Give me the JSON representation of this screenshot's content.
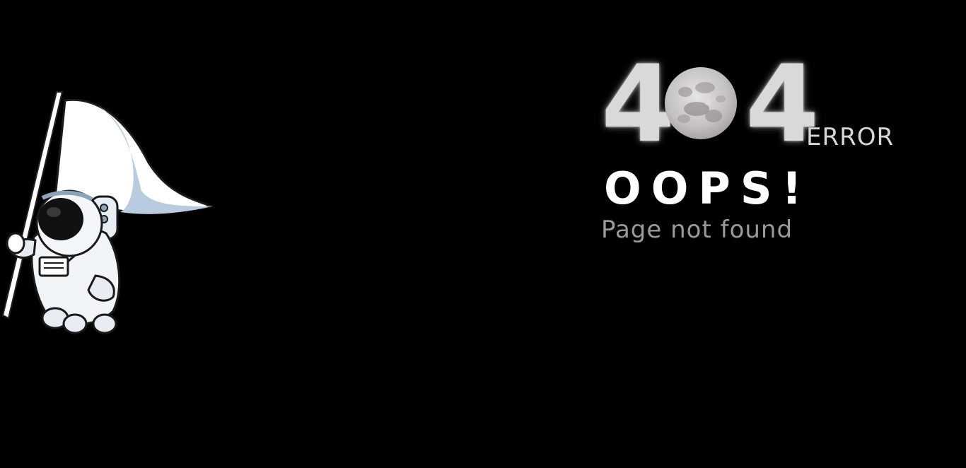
{
  "error_page": {
    "code_first_digit": "4",
    "code_last_digit": "4",
    "code_middle_icon": "moon-icon",
    "error_label": "ERROR",
    "headline": "OOPS!",
    "message": "Page not found"
  },
  "illustration": {
    "icon": "astronaut-with-flag-icon"
  },
  "colors": {
    "background": "#000000",
    "digit": "#d9d9d9",
    "headline": "#ffffff",
    "message": "#9a9a9a",
    "flag_shadow": "#b9cbde"
  }
}
